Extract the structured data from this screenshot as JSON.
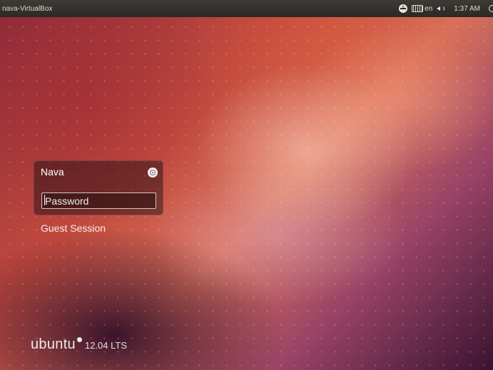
{
  "top_panel": {
    "hostname": "nava-VirtualBox",
    "language": "en",
    "time": "1:37 AM",
    "icons": [
      "accessibility-icon",
      "keyboard-icon",
      "volume-icon",
      "power-icon"
    ]
  },
  "greeter": {
    "user_name": "Nava",
    "password_placeholder": "Password",
    "password_value": "",
    "guest_session_label": "Guest Session",
    "session_icon": "ubuntu-session-icon"
  },
  "logo": {
    "wordmark": "ubuntu",
    "version": "12.04 LTS"
  },
  "colors": {
    "panel": "#2b2925",
    "accent": "#dd4814",
    "text": "#ffffff"
  }
}
